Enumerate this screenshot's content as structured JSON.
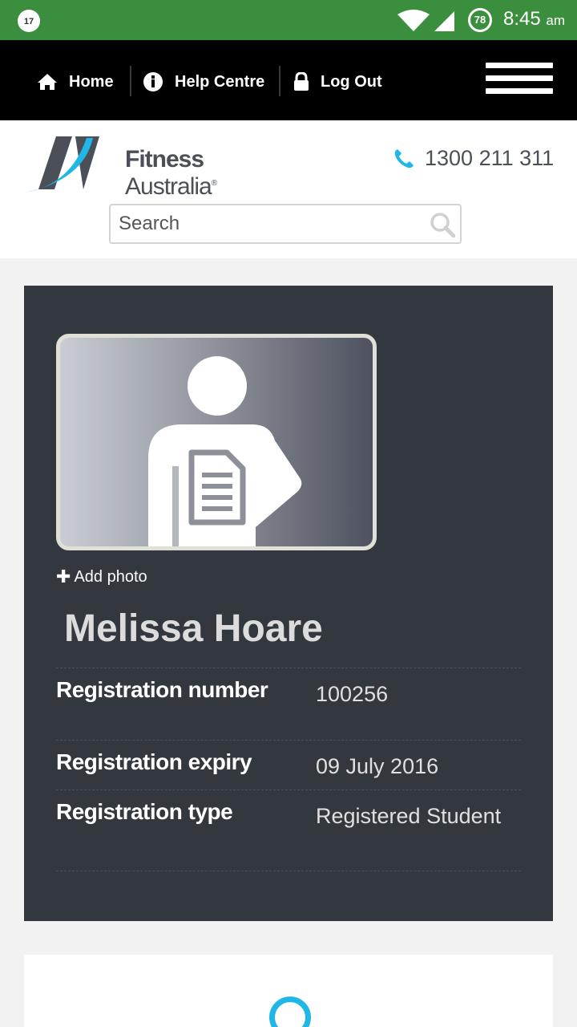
{
  "status_bar": {
    "notification_count": "17",
    "battery_level": "78",
    "time": "8:45",
    "ampm": "am"
  },
  "nav": {
    "home_label": "Home",
    "help_label": "Help Centre",
    "logout_label": "Log Out",
    "icons": [
      "home-icon",
      "info-icon",
      "lock-icon",
      "hamburger-menu-icon"
    ]
  },
  "brand": {
    "logo_text_bold": "Fitness",
    "logo_text_regular": " Australia",
    "logo_registered": "®",
    "phone_number": "1300 211 311"
  },
  "search": {
    "placeholder": "Search"
  },
  "profile": {
    "add_photo_label": "Add photo",
    "name": "Melissa Hoare",
    "details": [
      {
        "label": "Registration number",
        "value": "100256"
      },
      {
        "label": "Registration expiry",
        "value": "09 July 2016"
      },
      {
        "label": "Registration type",
        "value": "Registered Student"
      }
    ]
  },
  "colors": {
    "status_bar": "#3b8e3d",
    "nav_bg": "#000000",
    "card_bg": "#33373e",
    "accent_blue": "#1fb6e8",
    "logo_gray": "#4a4f58"
  }
}
